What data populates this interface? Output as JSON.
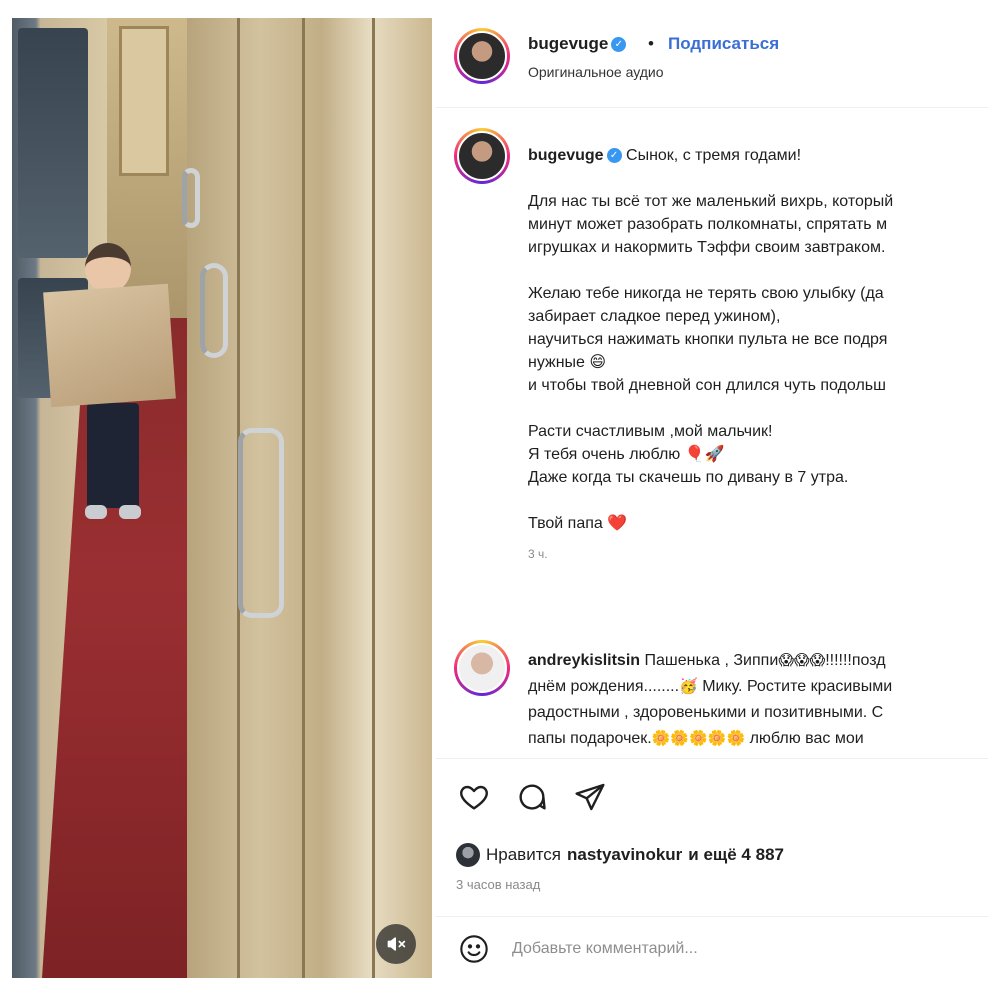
{
  "media": {
    "mute_icon": "speaker-muted-icon"
  },
  "header": {
    "username": "bugevuge",
    "separator": "•",
    "follow_label": "Подписаться",
    "audio_label": "Оригинальное аудио"
  },
  "caption": {
    "username": "bugevuge",
    "lines": [
      "Сынок, с тремя годами!",
      "",
      "Для нас ты всё тот же маленький вихрь, который",
      "минут может разобрать полкомнаты, спрятать м",
      "игрушках и накормить Тэффи своим завтраком.",
      "",
      "Желаю тебе никогда не терять свою улыбку (да",
      "забирает сладкое перед ужином),",
      "научиться нажимать кнопки пульта не все подря",
      "нужные 😄",
      "и чтобы твой дневной сон длился чуть подольш",
      "",
      "Расти счастливым ,мой мальчик!",
      "Я тебя очень люблю 🎈🚀",
      "Даже когда ты скачешь по дивану в 7 утра.",
      "",
      "Твой папа ❤️"
    ],
    "time": "3 ч."
  },
  "comment": {
    "username": "andreykislitsin",
    "line1_text": "Пашенька , Зиппи",
    "line1_emoji": "😱😱😱",
    "line1_tail": "!!!!!!позд",
    "line2_text": "днём рождения........",
    "line2_emoji": "🥳",
    "line2_tail": " Мику. Ростите красивыми",
    "line3": "радостными , здоровенькими и позитивными. С",
    "line4_text": "папы подарочек.",
    "line4_emoji": "🌼🌼🌼🌼🌼",
    "line4_tail": " люблю вас мои",
    "line5": "❤️❤️❤️❤️"
  },
  "actions": {
    "like_icon": "heart-outline-icon",
    "comment_icon": "speech-bubble-icon",
    "share_icon": "paper-plane-icon",
    "likes_prefix": "Нравится",
    "likes_user": "nastyavinokur",
    "likes_suffix": "и ещё 4 887",
    "posted_ago": "3 часов назад"
  },
  "add_comment": {
    "emoji_icon": "smiley-icon",
    "placeholder": "Добавьте комментарий..."
  },
  "colors": {
    "link_blue": "#3b6fd6",
    "verified_blue": "#3897f0",
    "heart_red": "#e0202e"
  }
}
